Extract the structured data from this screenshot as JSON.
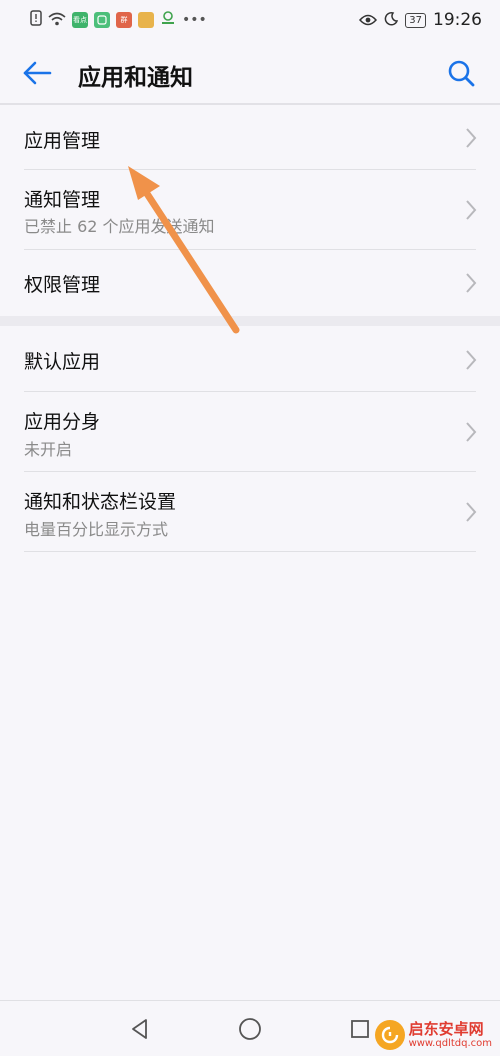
{
  "status_bar": {
    "time": "19:26",
    "battery": "37",
    "app_icons": [
      {
        "label": "看点",
        "color": "#3fb36b"
      },
      {
        "label": "",
        "color": "#4cbf7a"
      },
      {
        "label": "群",
        "color": "#e0654a"
      },
      {
        "label": "",
        "color": "#e8b34b"
      }
    ]
  },
  "header": {
    "title": "应用和通知"
  },
  "section1": [
    {
      "label": "应用管理",
      "sub": ""
    },
    {
      "label": "通知管理",
      "sub": "已禁止 62 个应用发送通知"
    },
    {
      "label": "权限管理",
      "sub": ""
    }
  ],
  "section2": [
    {
      "label": "默认应用",
      "sub": ""
    },
    {
      "label": "应用分身",
      "sub": "未开启"
    },
    {
      "label": "通知和状态栏设置",
      "sub": "电量百分比显示方式"
    }
  ],
  "watermark": {
    "name": "启东安卓网",
    "url": "www.qdltdq.com"
  },
  "colors": {
    "accent": "#1a73e8",
    "annotation_arrow": "#f0924a"
  }
}
